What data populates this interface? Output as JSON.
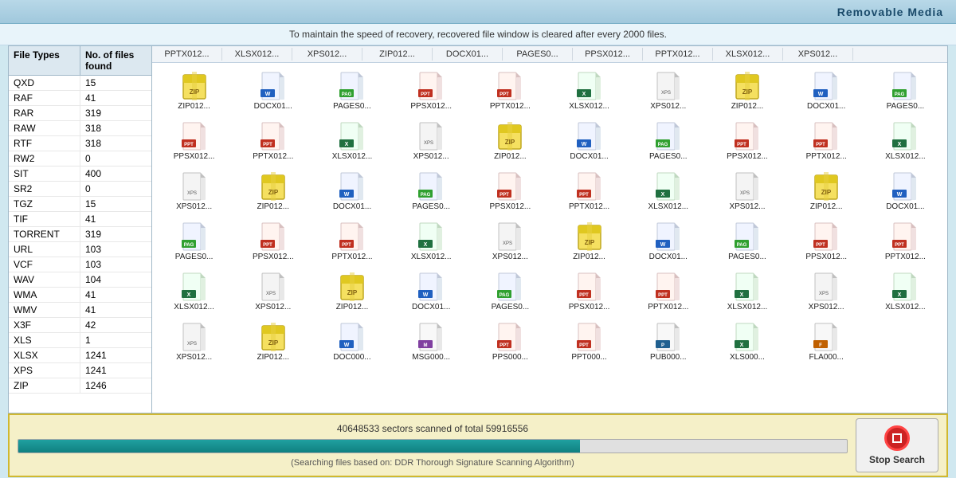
{
  "header": {
    "title": "Removable Media"
  },
  "info_bar": {
    "message": "To maintain the speed of recovery, recovered file window is cleared after every 2000 files."
  },
  "left_panel": {
    "col1_header": "File Types",
    "col2_header": "No. of files found",
    "rows": [
      {
        "type": "QXD",
        "count": "15"
      },
      {
        "type": "RAF",
        "count": "41"
      },
      {
        "type": "RAR",
        "count": "319"
      },
      {
        "type": "RAW",
        "count": "318"
      },
      {
        "type": "RTF",
        "count": "318"
      },
      {
        "type": "RW2",
        "count": "0"
      },
      {
        "type": "SIT",
        "count": "400"
      },
      {
        "type": "SR2",
        "count": "0"
      },
      {
        "type": "TGZ",
        "count": "15"
      },
      {
        "type": "TIF",
        "count": "41"
      },
      {
        "type": "TORRENT",
        "count": "319"
      },
      {
        "type": "URL",
        "count": "103"
      },
      {
        "type": "VCF",
        "count": "103"
      },
      {
        "type": "WAV",
        "count": "104"
      },
      {
        "type": "WMA",
        "count": "41"
      },
      {
        "type": "WMV",
        "count": "41"
      },
      {
        "type": "X3F",
        "count": "42"
      },
      {
        "type": "XLS",
        "count": "1"
      },
      {
        "type": "XLSX",
        "count": "1241"
      },
      {
        "type": "XPS",
        "count": "1241"
      },
      {
        "type": "ZIP",
        "count": "1246"
      }
    ]
  },
  "files_grid": {
    "header_row": [
      "PPTX012...",
      "XLSX012...",
      "XPS012...",
      "ZIP012...",
      "DOCX01...",
      "PAGES0...",
      "PPSX012...",
      "PPTX012...",
      "XLSX012...",
      "XPS012..."
    ],
    "files": [
      {
        "label": "ZIP012...",
        "type": "zip"
      },
      {
        "label": "DOCX01...",
        "type": "docx"
      },
      {
        "label": "PAGES0...",
        "type": "pages"
      },
      {
        "label": "PPSX012...",
        "type": "ppsx"
      },
      {
        "label": "PPTX012...",
        "type": "pptx"
      },
      {
        "label": "XLSX012...",
        "type": "xlsx"
      },
      {
        "label": "XPS012...",
        "type": "xps"
      },
      {
        "label": "ZIP012...",
        "type": "zip"
      },
      {
        "label": "DOCX01...",
        "type": "docx"
      },
      {
        "label": "PAGES0...",
        "type": "pages"
      },
      {
        "label": "PPSX012...",
        "type": "ppsx"
      },
      {
        "label": "PPTX012...",
        "type": "pptx"
      },
      {
        "label": "XLSX012...",
        "type": "xlsx"
      },
      {
        "label": "XPS012...",
        "type": "xps"
      },
      {
        "label": "ZIP012...",
        "type": "zip"
      },
      {
        "label": "DOCX01...",
        "type": "docx"
      },
      {
        "label": "PAGES0...",
        "type": "pages"
      },
      {
        "label": "PPSX012...",
        "type": "ppsx"
      },
      {
        "label": "PPTX012...",
        "type": "pptx"
      },
      {
        "label": "XLSX012...",
        "type": "xlsx"
      },
      {
        "label": "XPS012...",
        "type": "xps"
      },
      {
        "label": "ZIP012...",
        "type": "zip"
      },
      {
        "label": "DOCX01...",
        "type": "docx"
      },
      {
        "label": "PAGES0...",
        "type": "pages"
      },
      {
        "label": "PPSX012...",
        "type": "ppsx"
      },
      {
        "label": "PPTX012...",
        "type": "pptx"
      },
      {
        "label": "XLSX012...",
        "type": "xlsx"
      },
      {
        "label": "XPS012...",
        "type": "xps"
      },
      {
        "label": "ZIP012...",
        "type": "zip"
      },
      {
        "label": "DOCX01...",
        "type": "docx"
      },
      {
        "label": "PAGES0...",
        "type": "pages"
      },
      {
        "label": "PPSX012...",
        "type": "ppsx"
      },
      {
        "label": "PPTX012...",
        "type": "pptx"
      },
      {
        "label": "XLSX012...",
        "type": "xlsx"
      },
      {
        "label": "XPS012...",
        "type": "xps"
      },
      {
        "label": "ZIP012...",
        "type": "zip"
      },
      {
        "label": "DOCX01...",
        "type": "docx"
      },
      {
        "label": "PAGES0...",
        "type": "pages"
      },
      {
        "label": "PPSX012...",
        "type": "ppsx"
      },
      {
        "label": "PPTX012...",
        "type": "pptx"
      },
      {
        "label": "XLSX012...",
        "type": "xlsx"
      },
      {
        "label": "XPS012...",
        "type": "xps"
      },
      {
        "label": "ZIP012...",
        "type": "zip"
      },
      {
        "label": "DOCX01...",
        "type": "docx"
      },
      {
        "label": "PAGES0...",
        "type": "pages"
      },
      {
        "label": "PPSX012...",
        "type": "ppsx"
      },
      {
        "label": "PPTX012...",
        "type": "pptx"
      },
      {
        "label": "XLSX012...",
        "type": "xlsx"
      },
      {
        "label": "XPS012...",
        "type": "xps"
      },
      {
        "label": "XLSX012...",
        "type": "xlsx"
      },
      {
        "label": "XPS012...",
        "type": "xps"
      },
      {
        "label": "ZIP012...",
        "type": "zip"
      },
      {
        "label": "DOC000...",
        "type": "docx"
      },
      {
        "label": "MSG000...",
        "type": "msg"
      },
      {
        "label": "PPS000...",
        "type": "ppsx"
      },
      {
        "label": "PPT000...",
        "type": "pptx"
      },
      {
        "label": "PUB000...",
        "type": "pub"
      },
      {
        "label": "XLS000...",
        "type": "xlsx"
      },
      {
        "label": "FLA000...",
        "type": "fla"
      }
    ]
  },
  "status_bar": {
    "progress_text": "40648533 sectors scanned of total 59916556",
    "progress_percent": 67.8,
    "algo_text": "(Searching files based on:  DDR Thorough Signature Scanning Algorithm)",
    "stop_button_label": "Stop Search"
  }
}
